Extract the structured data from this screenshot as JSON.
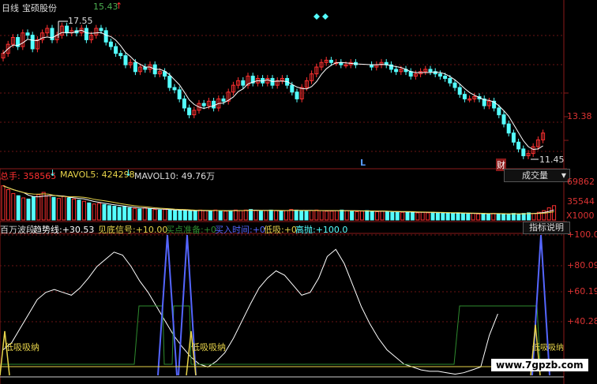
{
  "header": {
    "period_label": "日线",
    "stock_name": "宝硕股份",
    "last_price": "15.43",
    "up_arrow": "↑"
  },
  "price_panel": {
    "high_label": "17.55",
    "low_label": "11.45",
    "axis_label": "13.38",
    "marker_L": "L",
    "marker_cai": "财",
    "colors": {
      "up": "#ff3030",
      "down": "#54ffff",
      "ma": "#ffffff",
      "diamond": "#54ffff"
    },
    "closes": [
      16.0,
      16.4,
      16.7,
      16.3,
      16.9,
      16.8,
      16.2,
      16.6,
      16.9,
      17.1,
      16.6,
      16.8,
      17.2,
      16.9,
      17.0,
      16.9,
      17.1,
      16.6,
      16.8,
      17.1,
      17.0,
      16.5,
      16.3,
      16.0,
      15.9,
      15.5,
      15.6,
      15.2,
      15.4,
      15.3,
      15.5,
      15.1,
      15.2,
      15.0,
      14.5,
      14.4,
      14.0,
      13.6,
      13.3,
      13.5,
      13.8,
      13.7,
      13.9,
      13.6,
      14.0,
      13.9,
      14.3,
      14.6,
      14.8,
      14.6,
      15.0,
      14.7,
      14.9,
      14.7,
      14.9,
      14.6,
      14.8,
      14.9,
      14.6,
      14.3,
      14.0,
      14.5,
      14.8,
      15.1,
      15.4,
      15.6,
      15.7,
      15.6,
      15.6,
      15.5,
      15.5,
      15.6,
      15.5,
      15.4,
      15.5,
      15.6,
      15.5,
      15.3,
      15.2,
      15.3,
      15.2,
      15.0,
      15.1,
      15.2,
      15.3,
      15.2,
      15.1,
      15.0,
      14.9,
      14.7,
      14.5,
      14.2,
      14.0,
      14.0,
      14.1,
      14.0,
      13.7,
      13.9,
      13.6,
      13.3,
      12.9,
      12.5,
      12.1,
      11.8,
      11.5,
      11.6,
      11.9,
      12.2,
      12.5
    ]
  },
  "volume_panel": {
    "total_label": "总手: 358565",
    "mavol5_label": "MAVOL5: 424298",
    "mavol10_label": "MAVOL10: 49.76万",
    "axis_labels": [
      "69862",
      "35544",
      "X1000"
    ],
    "dropdown_label": "成交量",
    "dropdown_arrow": "▼",
    "colors": {
      "up": "#ff3030",
      "down": "#54ffff",
      "ma5": "#ffffff",
      "ma10": "#e8d44a"
    },
    "volumes": [
      62,
      55,
      48,
      44,
      40,
      38,
      42,
      46,
      50,
      44,
      41,
      39,
      43,
      40,
      38,
      36,
      34,
      31,
      29,
      30,
      28,
      26,
      25,
      23,
      24,
      22,
      21,
      20,
      22,
      20,
      19,
      18,
      19,
      18,
      17,
      18,
      17,
      16,
      17,
      18,
      17,
      16,
      18,
      17,
      16,
      17,
      18,
      17,
      18,
      19,
      17,
      16,
      17,
      18,
      17,
      16,
      17,
      19,
      18,
      17,
      16,
      17,
      18,
      17,
      16,
      16,
      17,
      18,
      17,
      16,
      15,
      16,
      17,
      16,
      15,
      16,
      15,
      14,
      15,
      14,
      15,
      14,
      13,
      14,
      13,
      14,
      13,
      12,
      13,
      12,
      13,
      12,
      11,
      12,
      11,
      12,
      11,
      12,
      11,
      10,
      11,
      12,
      11,
      12,
      13,
      12,
      14,
      17,
      22,
      26
    ]
  },
  "indicator_panel": {
    "name": "百万波段",
    "items": [
      {
        "label": "趋势线:",
        "value": "+30.53",
        "color": "#ffffff"
      },
      {
        "label": "见底信号:",
        "value": "+10.00",
        "color": "#e8d44a"
      },
      {
        "label": "买点准备:",
        "value": "+0",
        "color": "#2e8b2e"
      },
      {
        "label": "买入时间:",
        "value": "+0",
        "color": "#5566ff"
      },
      {
        "label": "低吸:",
        "value": "+0",
        "color": "#e8d44a"
      },
      {
        "label": "高抛:",
        "value": "+100.0",
        "color": "#54ffff"
      }
    ],
    "help_button": "指标说明",
    "axis_labels": [
      "+100.0",
      "+80.09",
      "+60.19",
      "+40.28"
    ],
    "annotations": [
      "低吸吸纳",
      "低吸吸纳",
      "低吸吸纳"
    ],
    "trend_series": [
      20,
      25,
      35,
      45,
      55,
      60,
      62,
      60,
      58,
      63,
      70,
      78,
      83,
      88,
      86,
      78,
      68,
      60,
      50,
      40,
      30,
      22,
      15,
      10,
      8,
      12,
      18,
      28,
      40,
      52,
      63,
      70,
      75,
      72,
      65,
      58,
      60,
      70,
      85,
      90,
      80,
      65,
      50,
      38,
      28,
      20,
      15,
      10,
      8,
      6,
      5,
      5,
      4,
      3,
      4,
      6,
      8,
      30,
      45
    ]
  },
  "watermark": "www.7gpzb.com"
}
